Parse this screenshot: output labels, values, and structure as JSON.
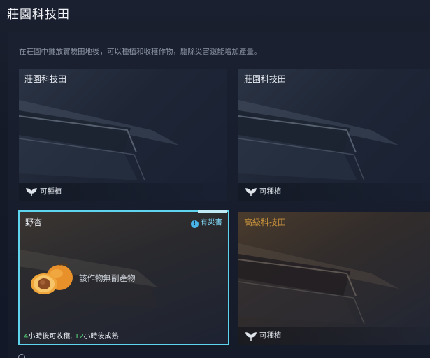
{
  "header": {
    "title": "莊園科技田"
  },
  "description": "在莊園中擺放實驗田地後，可以種植和收穫作物，驅除災害還能增加產量。",
  "cards": [
    {
      "title": "莊園科技田",
      "status": "可種植",
      "icon": "sprout-icon"
    },
    {
      "title": "莊園科技田",
      "status": "可種植",
      "icon": "sprout-icon"
    },
    {
      "title": "野杏",
      "hazard": "有災害",
      "hazard_icon": "exclamation-icon",
      "crop_icon": "apricot-icon",
      "byproduct": "該作物無副產物",
      "harvest_hours": "4",
      "harvest_text": "小時後可收穫,",
      "mature_hours": "12",
      "mature_text": "小時後成熟",
      "selected": true
    },
    {
      "title": "高級科技田",
      "status": "可種植",
      "icon": "sprout-icon"
    }
  ],
  "colors": {
    "selected_border": "#5fd4ee",
    "hazard_text": "#7fd5f3",
    "timer_highlight": "#58e07a",
    "advanced_title": "#c8933c"
  }
}
